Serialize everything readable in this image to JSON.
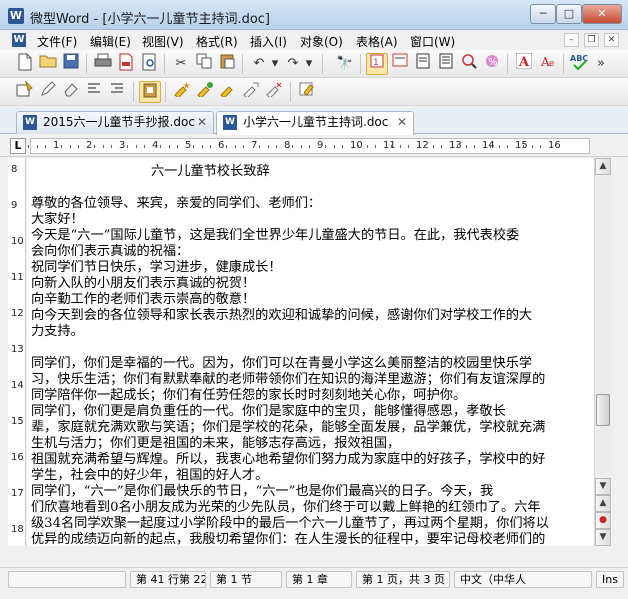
{
  "window": {
    "app_icon": "W",
    "title": "微型Word - [小学六一儿童节主持词.doc]",
    "controls": {
      "minimize": "─",
      "maximize": "□",
      "close": "✕"
    }
  },
  "menubar": {
    "items": [
      "文件(F)",
      "编辑(E)",
      "视图(V)",
      "格式(R)",
      "插入(I)",
      "对象(O)",
      "表格(A)",
      "窗口(W)"
    ],
    "mdi_controls": {
      "minimize": "–",
      "restore": "❐",
      "close": "✕"
    }
  },
  "toolbar1": {
    "icons": [
      "new-document",
      "open-folder",
      "save",
      "print",
      "export-pdf",
      "print-preview",
      "cut",
      "copy",
      "paste",
      "undo",
      "redo",
      "find",
      "view-mode-1",
      "view-mode-2",
      "view-mode-3",
      "view-mode-4",
      "zoom",
      "insert-link",
      "text-color",
      "font-size",
      "spell-check",
      "more"
    ]
  },
  "toolbar2": {
    "icons": [
      "style-format",
      "edit-mark",
      "align-1",
      "align-2",
      "clipboard",
      "star-1",
      "star-2",
      "star-3",
      "star-4",
      "star-5",
      "options"
    ]
  },
  "tabs": [
    {
      "label": "2015六一儿童节手抄报.doc",
      "active": false
    },
    {
      "label": "小学六一儿童节主持词.doc",
      "active": true
    }
  ],
  "ruler": {
    "corner": "L",
    "numbers": [
      "1",
      "2",
      "3",
      "4",
      "5",
      "6",
      "7",
      "8",
      "9",
      "10",
      "11",
      "12",
      "13",
      "14",
      "15",
      "16"
    ]
  },
  "vruler": {
    "numbers": [
      "8",
      "9",
      "10",
      "11",
      "12",
      "13",
      "14",
      "15",
      "16",
      "17",
      "18"
    ]
  },
  "document": {
    "lines": [
      "六一儿童节校长致辞",
      "",
      "  尊敬的各位领导、来宾，亲爱的同学们、老师们：",
      "大家好！",
      "    今天是“六一”国际儿童节，这是我们全世界少年儿童盛大的节日。在此，我代表校委",
      "会向你们表示真诚的祝福：",
      "    祝同学们节日快乐，学习进步，健康成长！",
      "    向新入队的小朋友们表示真诚的祝贺！",
      "    向辛勤工作的老师们表示崇高的敬意！",
      "    向今天到会的各位领导和家长表示热烈的欢迎和诚挚的问候，感谢你们对学校工作的大",
      "力支持。",
      "",
      "    同学们，你们是幸福的一代。因为，你们可以在青曼小学这么美丽整洁的校园里快乐学",
      "习，快乐生活；你们有默默奉献的老师带领你们在知识的海洋里遨游；你们有友谊深厚的",
      "同学陪伴你一起成长；你们有任劳任怨的家长时时刻刻地关心你，呵护你。",
      "     同学们，你们更是肩负重任的一代。你们是家庭中的宝贝，能够懂得感恩，孝敬长",
      "辈，家庭就充满欢歌与笑语；你们是学校的花朵，能够全面发展，品学兼优，学校就充满",
      "生机与活力；你们更是祖国的未来，能够志存高远，报效祖国，",
      "祖国就充满希望与辉煌。所以，我衷心地希望你们努力成为家庭中的好孩子，学校中的好",
      "学生，社会中的好少年，祖国的好人才。",
      "    同学们，“六一”是你们最快乐的节日，“六一”也是你们最高兴的日子。今天，我",
      "们欣喜地看到0名小朋友成为光荣的少先队员，你们终于可以戴上鲜艳的红领巾了。六年",
      "级34名同学欢聚一起度过小学阶段中的最后一个六一儿童节了，再过两个星期，你们将以",
      "优异的成绩迈向新的起点，我殷切希望你们：在人生漫长的征程中，要牢记母校老师们的"
    ]
  },
  "scrollbar": {
    "up": "▲",
    "down": "▼",
    "prev_page": "▲",
    "select_browse": "●",
    "next_page": "▼"
  },
  "statusbar": {
    "position": "第 41 行第 22",
    "section_col": "第 1 节",
    "chapter": "第 1 章",
    "pages": "第 1 页，共 3 页",
    "language": "中文（中华人",
    "mode": "Ins"
  }
}
